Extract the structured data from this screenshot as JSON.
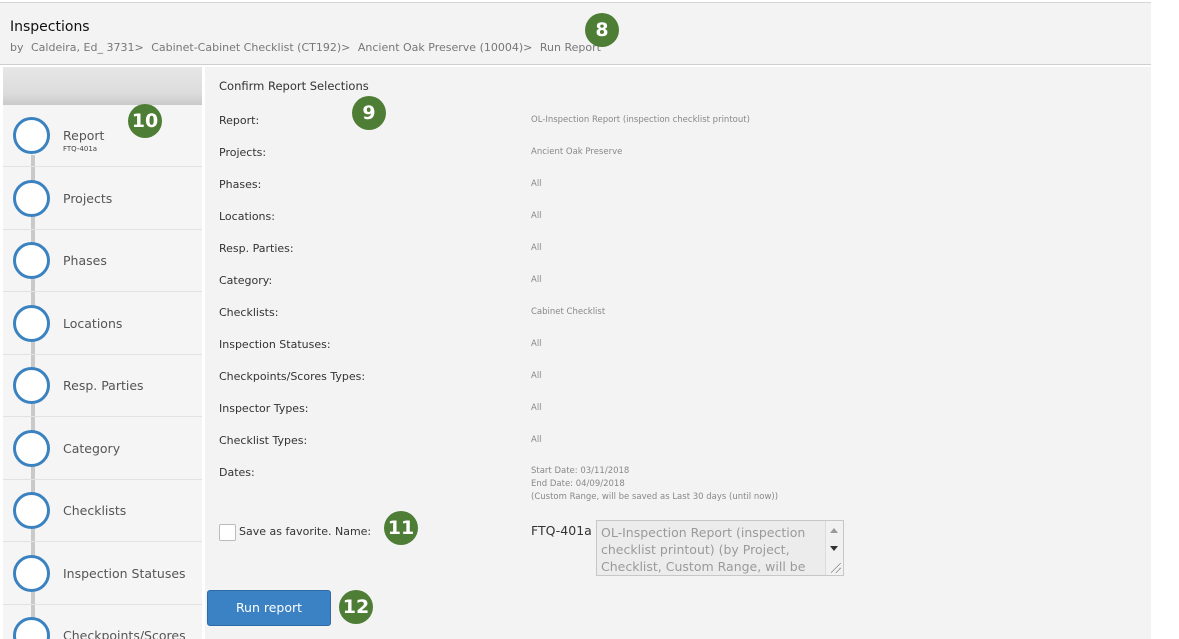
{
  "header": {
    "title": "Inspections",
    "breadcrumbs": [
      "by",
      "Caldeira, Ed_ 3731>",
      "Cabinet-Cabinet Checklist (CT192)>",
      "Ancient Oak Preserve (10004)>",
      "Run Report"
    ]
  },
  "callouts": [
    "8",
    "9",
    "10",
    "11",
    "12"
  ],
  "sidebar": {
    "steps": [
      {
        "label": "Report",
        "sub": "FTQ-401a"
      },
      {
        "label": "Projects"
      },
      {
        "label": "Phases"
      },
      {
        "label": "Locations"
      },
      {
        "label": "Resp. Parties"
      },
      {
        "label": "Category"
      },
      {
        "label": "Checklists"
      },
      {
        "label": "Inspection Statuses"
      },
      {
        "label": "Checkpoints/Scores"
      }
    ]
  },
  "main": {
    "heading": "Confirm Report Selections",
    "rows": [
      {
        "label": "Report:",
        "value": "OL-Inspection Report (inspection checklist printout)"
      },
      {
        "label": "Projects:",
        "value": "Ancient Oak Preserve"
      },
      {
        "label": "Phases:",
        "value": "All"
      },
      {
        "label": "Locations:",
        "value": "All"
      },
      {
        "label": "Resp. Parties:",
        "value": "All"
      },
      {
        "label": "Category:",
        "value": "All"
      },
      {
        "label": "Checklists:",
        "value": "Cabinet Checklist"
      },
      {
        "label": "Inspection Statuses:",
        "value": "All"
      },
      {
        "label": "Checkpoints/Scores Types:",
        "value": "All"
      },
      {
        "label": "Inspector Types:",
        "value": "All"
      },
      {
        "label": "Checklist Types:",
        "value": "All"
      }
    ],
    "dates": {
      "label": "Dates:",
      "start": "Start Date: 03/11/2018",
      "end": "End Date: 04/09/2018",
      "note": "(Custom Range, will be saved as Last 30 days (until now))"
    },
    "favorite": {
      "label": "Save as favorite. Name:",
      "code": "FTQ-401a",
      "name_value": "OL-Inspection Report (inspection checklist printout) (by Project, Checklist, Custom Range, will be"
    },
    "run_label": "Run report"
  },
  "colors": {
    "accent": "#3a82c4",
    "callout": "#4e7d35",
    "step_circle": "#3b82c0"
  },
  "icons": {
    "dropdown_up": "triangle-up",
    "dropdown_down": "triangle-down",
    "resize": "resize-grip"
  }
}
